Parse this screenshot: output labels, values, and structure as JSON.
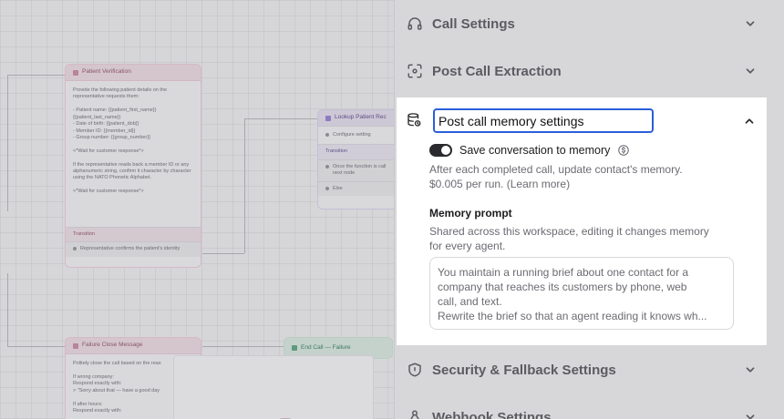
{
  "canvas": {
    "patient_node": {
      "title": "Patient Verification",
      "body": "Provide the following patient details on the representative requests them:\n\n- Patient name: {{patient_first_name}} {{patient_last_name}}\n- Date of birth: {{patient_dob}}\n- Member ID: {{member_id}}\n- Group number: {{group_number}}\n\n<*Wait for customer response*>\n\nIf the representative reads back a member ID or any alphanumeric string, confirm it character by character using the NATO Phonetic Alphabet.\n\n<*Wait for customer response*>",
      "section": "Transition",
      "transition": "Representative confirms the patient's identity"
    },
    "lookup_node": {
      "title": "Lookup Patient Rec",
      "config": "Configure setting",
      "section": "Transition",
      "transition": "Once the function is call next node",
      "else": "Else"
    },
    "failure_node": {
      "title": "Failure Close Message",
      "body": "Politely close the call based on the reas\n\nIf wrong company:\nRespond exactly with:\n> \"Sorry about that — have a good day\n\nIf after hours:\nRespond exactly with:"
    },
    "end_node": {
      "title": "End Call — Failure"
    }
  },
  "panel": {
    "sections": {
      "call_settings": "Call Settings",
      "post_call_extraction": "Post Call Extraction",
      "security": "Security & Fallback Settings",
      "webhook": "Webhook Settings"
    },
    "memory": {
      "title_value": "Post call memory settings",
      "toggle_label": "Save conversation to memory",
      "toggle_on": true,
      "desc_line1": "After each completed call, update contact's memory.",
      "desc_line2": "$0.005 per run. (Learn more)",
      "prompt_label": "Memory prompt",
      "prompt_desc_line1": "Shared across this workspace, editing it changes memory",
      "prompt_desc_line2": "for every agent.",
      "prompt_lines": [
        "You maintain a running brief about one contact for a",
        "company that reaches its customers by phone, web",
        "call, and text.",
        "Rewrite the brief so that an agent reading it knows wh..."
      ]
    }
  },
  "colors": {
    "accent": "#2b5fd9",
    "toggle_on": "#2a2a2e"
  }
}
